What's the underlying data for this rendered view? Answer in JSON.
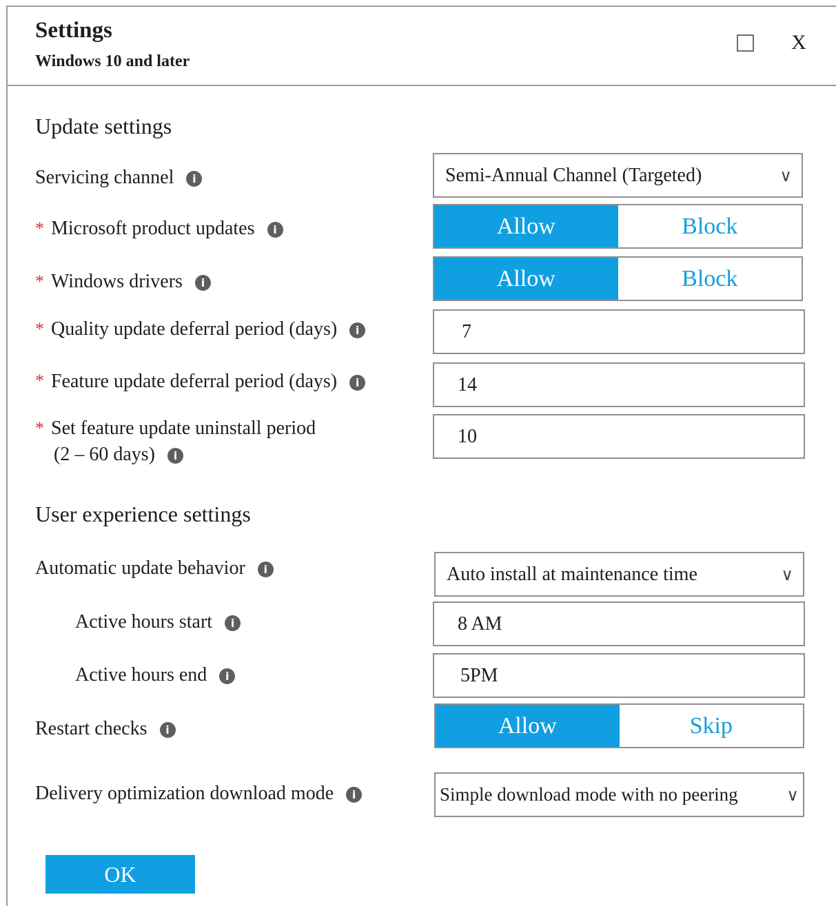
{
  "window": {
    "title": "Settings",
    "subtitle": "Windows 10 and later",
    "close_label": "X"
  },
  "update_settings": {
    "heading": "Update settings",
    "servicing_channel": {
      "label": "Servicing channel",
      "value": "Semi-Annual Channel (Targeted)"
    },
    "microsoft_product_updates": {
      "label": "Microsoft product updates",
      "options": [
        "Allow",
        "Block"
      ],
      "selected": "Allow"
    },
    "windows_drivers": {
      "label": "Windows drivers",
      "options": [
        "Allow",
        "Block"
      ],
      "selected": "Allow"
    },
    "quality_deferral": {
      "label": "Quality update deferral period (days)",
      "value": "7"
    },
    "feature_deferral": {
      "label": "Feature update deferral period (days)",
      "value": "14"
    },
    "feature_uninstall": {
      "label_line1": "Set feature update uninstall period",
      "label_line2": "(2 – 60 days)",
      "value": "10"
    }
  },
  "user_experience": {
    "heading": "User experience settings",
    "automatic_update_behavior": {
      "label": "Automatic update behavior",
      "value": "Auto install at maintenance time"
    },
    "active_hours_start": {
      "label": "Active hours start",
      "value": "8 AM"
    },
    "active_hours_end": {
      "label": "Active hours end",
      "value": "5PM"
    },
    "restart_checks": {
      "label": "Restart checks",
      "options": [
        "Allow",
        "Skip"
      ],
      "selected": "Allow"
    },
    "delivery_optimization": {
      "label": "Delivery optimization download mode",
      "value": "Simple download mode with no peering"
    }
  },
  "icons": {
    "info": "info-icon",
    "required_marker": "*",
    "chevron": "chevron-down-icon"
  },
  "footer": {
    "ok_label": "OK"
  },
  "colors": {
    "accent": "#109fe0",
    "required": "#d13438",
    "border": "#8f8f8f"
  }
}
